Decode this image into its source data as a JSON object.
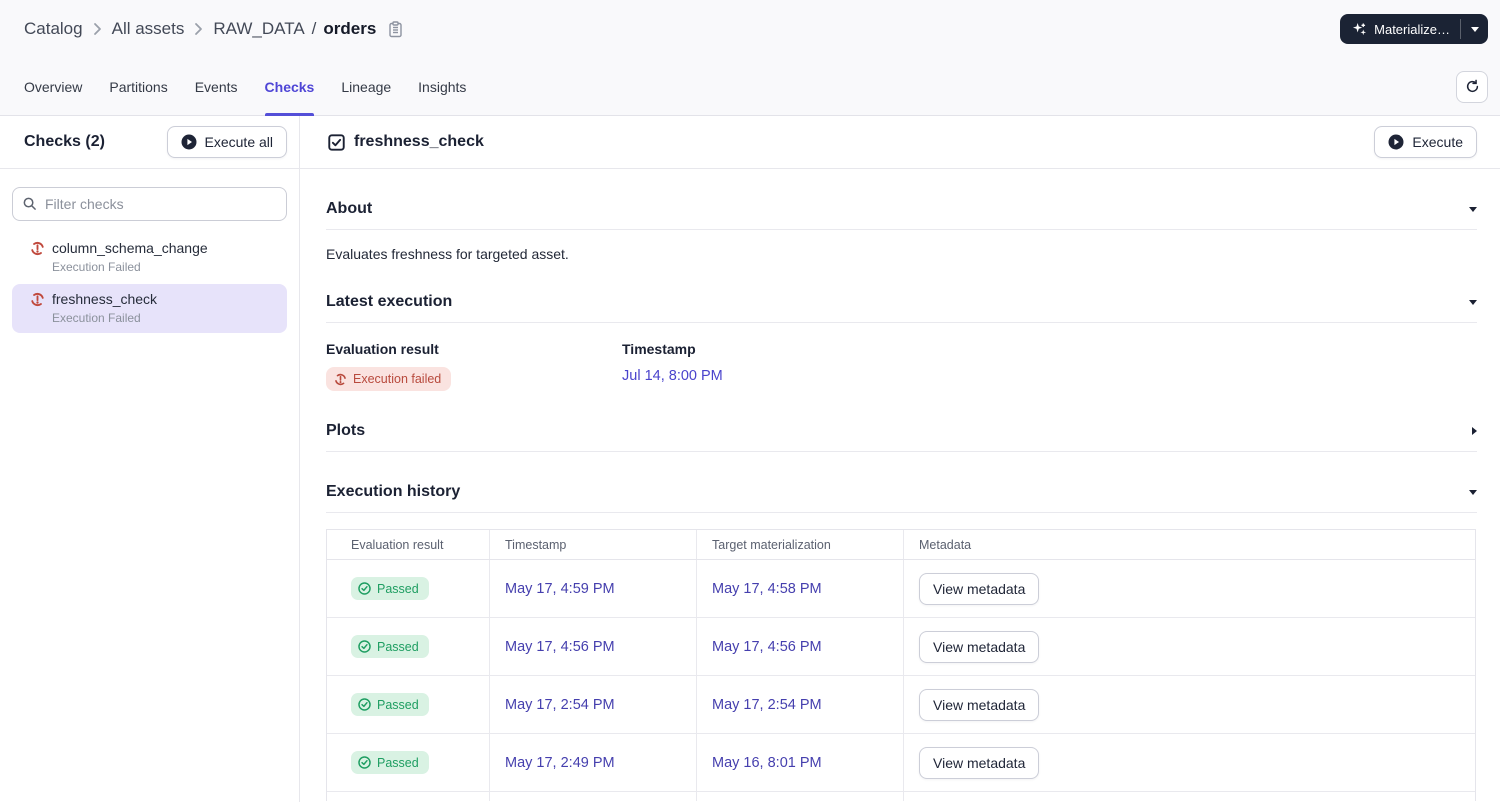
{
  "breadcrumb": {
    "catalog": "Catalog",
    "all_assets": "All assets",
    "asset_group": "RAW_DATA",
    "path_separator": "/",
    "asset_name": "orders"
  },
  "header": {
    "materialize_label": "Materialize…"
  },
  "tabs": [
    {
      "label": "Overview",
      "active": false
    },
    {
      "label": "Partitions",
      "active": false
    },
    {
      "label": "Events",
      "active": false
    },
    {
      "label": "Checks",
      "active": true
    },
    {
      "label": "Lineage",
      "active": false
    },
    {
      "label": "Insights",
      "active": false
    }
  ],
  "sidebar": {
    "title": "Checks (2)",
    "execute_all_label": "Execute all",
    "filter_placeholder": "Filter checks",
    "items": [
      {
        "name": "column_schema_change",
        "status": "Execution Failed",
        "selected": false
      },
      {
        "name": "freshness_check",
        "status": "Execution Failed",
        "selected": true
      }
    ]
  },
  "main": {
    "title": "freshness_check",
    "execute_label": "Execute",
    "about": {
      "heading": "About",
      "description": "Evaluates freshness for targeted asset."
    },
    "latest_execution": {
      "heading": "Latest execution",
      "evaluation_result_label": "Evaluation result",
      "evaluation_result_badge": "Execution failed",
      "timestamp_label": "Timestamp",
      "timestamp_value": "Jul 14, 8:00 PM"
    },
    "plots": {
      "heading": "Plots"
    },
    "execution_history": {
      "heading": "Execution history",
      "columns": [
        "Evaluation result",
        "Timestamp",
        "Target materialization",
        "Metadata"
      ],
      "rows": [
        {
          "result": "Passed",
          "timestamp": "May 17, 4:59 PM",
          "target": "May 17, 4:58 PM",
          "metadata_label": "View metadata"
        },
        {
          "result": "Passed",
          "timestamp": "May 17, 4:56 PM",
          "target": "May 17, 4:56 PM",
          "metadata_label": "View metadata"
        },
        {
          "result": "Passed",
          "timestamp": "May 17, 2:54 PM",
          "target": "May 17, 2:54 PM",
          "metadata_label": "View metadata"
        },
        {
          "result": "Passed",
          "timestamp": "May 17, 2:49 PM",
          "target": "May 16, 8:01 PM",
          "metadata_label": "View metadata"
        }
      ]
    }
  },
  "colors": {
    "accent_indigo": "#4f46d6",
    "dark_navy": "#1b2334",
    "failed_bg": "#fae3e0",
    "failed_text": "#b84a3d",
    "passed_bg": "#d9f2e3",
    "passed_text": "#1f9e62",
    "link": "#453fae",
    "selected_item_bg": "#e7e3fa"
  }
}
